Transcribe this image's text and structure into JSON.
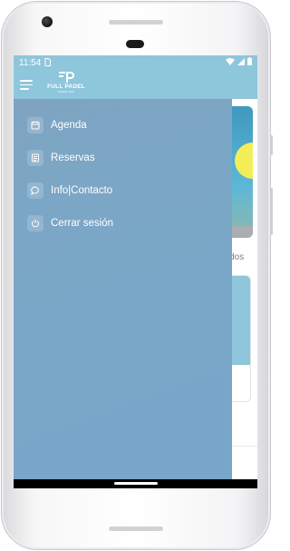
{
  "statusbar": {
    "time": "11:54",
    "sd_icon": "sd-card-icon",
    "wifi_icon": "wifi-icon",
    "signal_icon": "signal-icon",
    "battery_icon": "battery-icon"
  },
  "appbar": {
    "menu_icon": "hamburger-icon",
    "logo_text": "FULL PADEL",
    "logo_sub": "DESDE 1998"
  },
  "background": {
    "partial_text": "dos"
  },
  "drawer": {
    "items": [
      {
        "label": "Agenda",
        "icon": "calendar-icon"
      },
      {
        "label": "Reservas",
        "icon": "list-icon"
      },
      {
        "label": "Info|Contacto",
        "icon": "chat-icon"
      },
      {
        "label": "Cerrar sesión",
        "icon": "power-icon"
      }
    ]
  },
  "colors": {
    "header": "#8ec6dc",
    "drawer": "#7ba7c7",
    "text": "#ffffff"
  }
}
